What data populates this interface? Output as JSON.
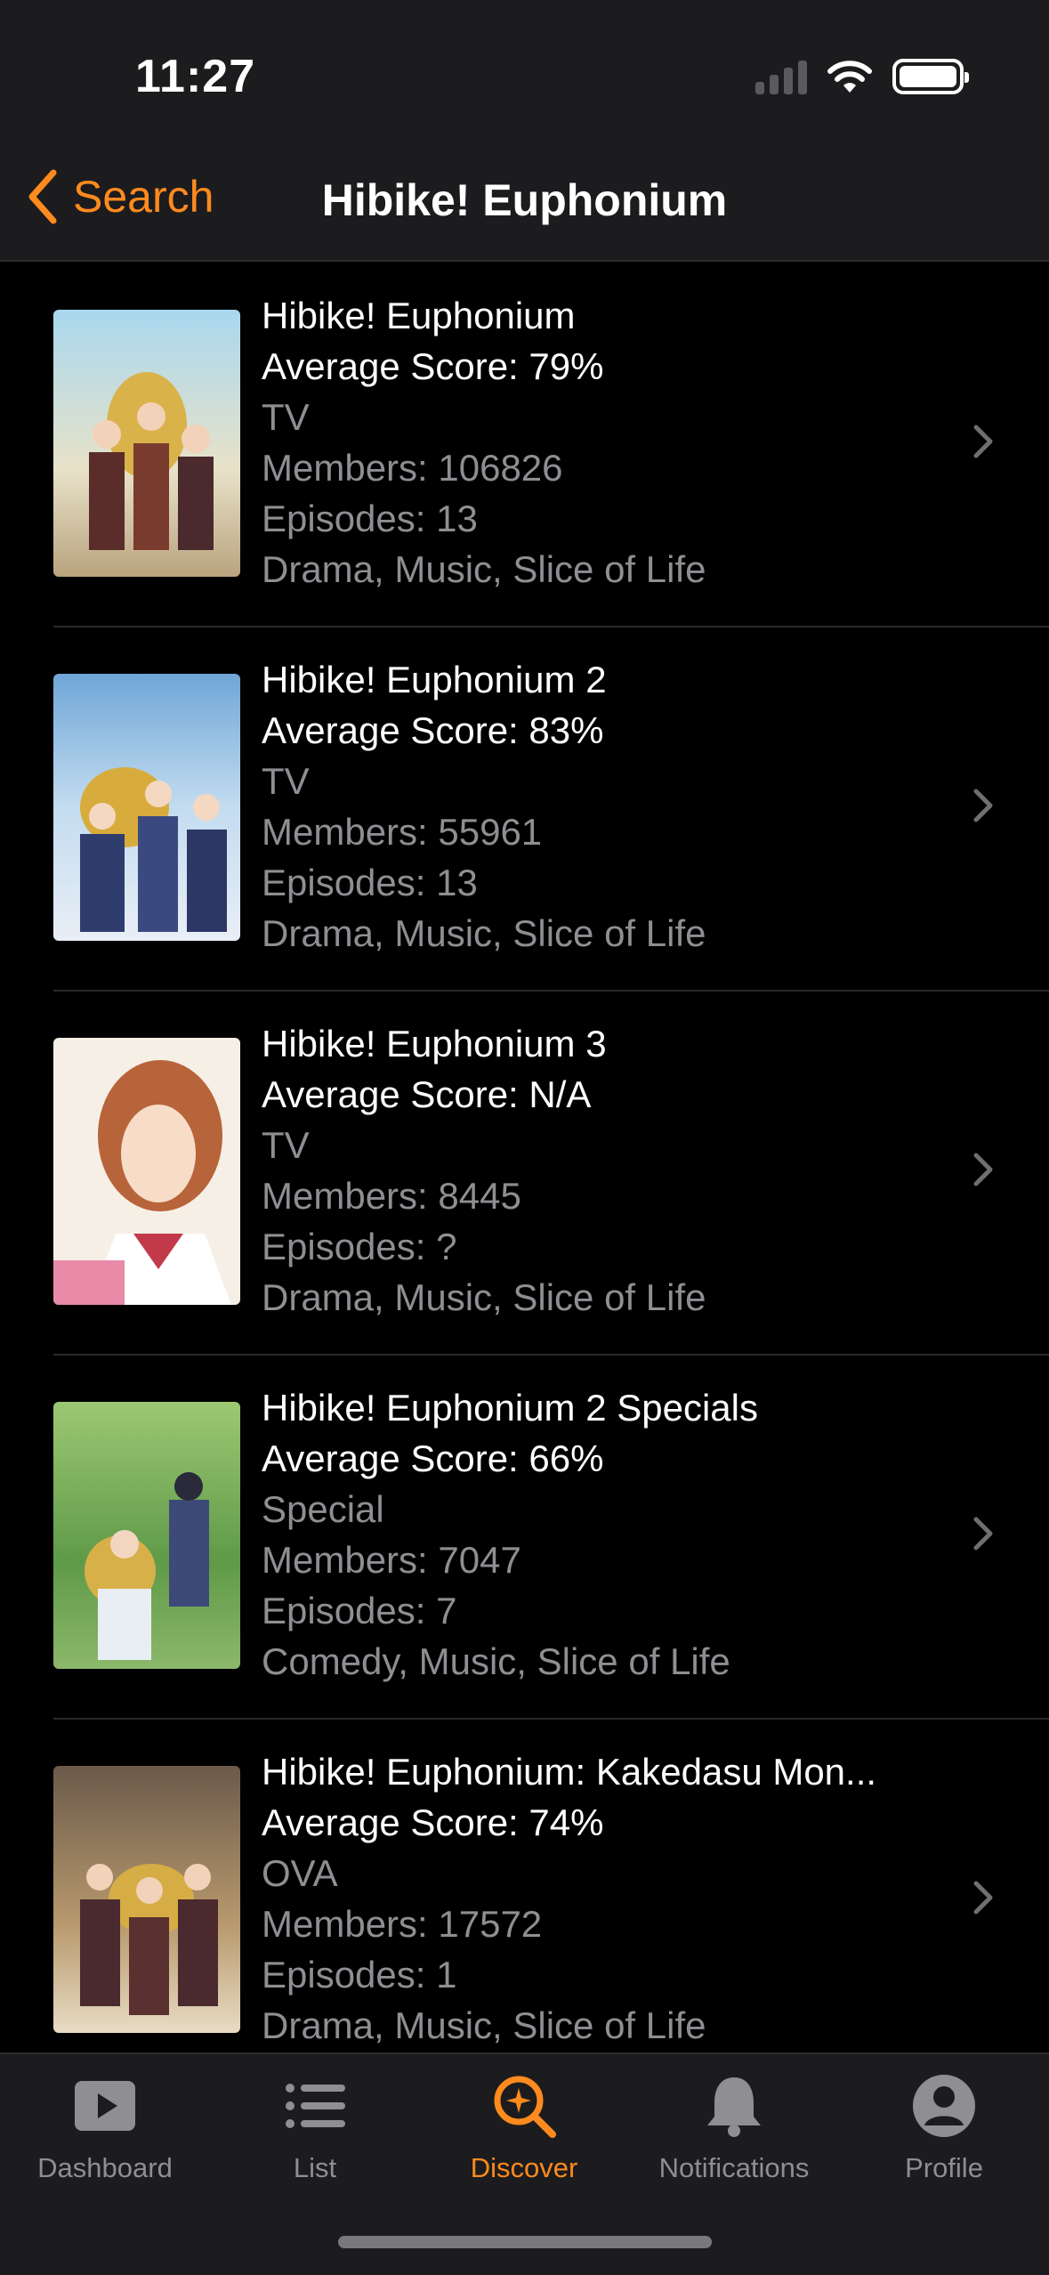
{
  "status_bar": {
    "time": "11:27"
  },
  "nav": {
    "back_label": "Search",
    "title": "Hibike! Euphonium"
  },
  "results": [
    {
      "title": "Hibike! Euphonium",
      "score": "Average Score: 79%",
      "format": "TV",
      "members": "Members: 106826",
      "episodes": "Episodes: 13",
      "genres": "Drama, Music, Slice of Life"
    },
    {
      "title": "Hibike! Euphonium 2",
      "score": "Average Score: 83%",
      "format": "TV",
      "members": "Members: 55961",
      "episodes": "Episodes: 13",
      "genres": "Drama, Music, Slice of Life"
    },
    {
      "title": "Hibike! Euphonium 3",
      "score": "Average Score: N/A",
      "format": "TV",
      "members": "Members: 8445",
      "episodes": "Episodes: ?",
      "genres": "Drama, Music, Slice of Life"
    },
    {
      "title": "Hibike! Euphonium 2 Specials",
      "score": "Average Score: 66%",
      "format": "Special",
      "members": "Members: 7047",
      "episodes": "Episodes: 7",
      "genres": "Comedy, Music, Slice of Life"
    },
    {
      "title": "Hibike! Euphonium: Kakedasu Mon...",
      "score": "Average Score: 74%",
      "format": "OVA",
      "members": "Members: 17572",
      "episodes": "Episodes: 1",
      "genres": "Drama, Music, Slice of Life"
    }
  ],
  "tabs": [
    {
      "label": "Dashboard",
      "icon": "play-icon"
    },
    {
      "label": "List",
      "icon": "list-icon"
    },
    {
      "label": "Discover",
      "icon": "discover-search-icon"
    },
    {
      "label": "Notifications",
      "icon": "bell-icon"
    },
    {
      "label": "Profile",
      "icon": "person-icon"
    }
  ],
  "colors": {
    "accent": "#ff8a1e",
    "muted": "#8e8e93",
    "bar": "#1c1c1e"
  }
}
